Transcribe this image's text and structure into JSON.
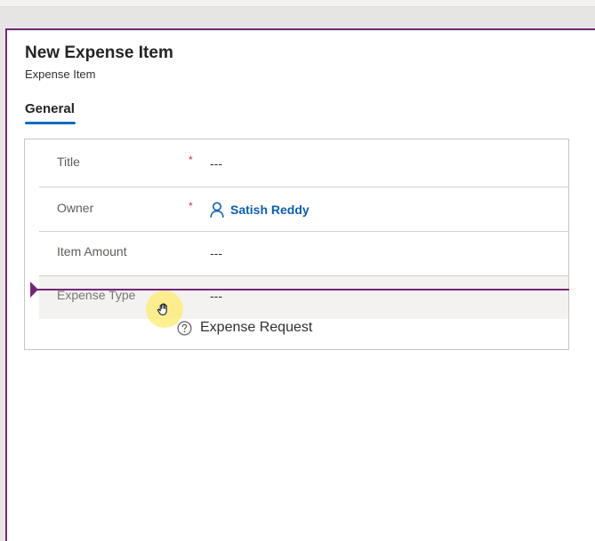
{
  "form": {
    "title": "New Expense Item",
    "subtitle": "Expense Item"
  },
  "tabs": [
    {
      "label": "General",
      "selected": true
    }
  ],
  "fields": [
    {
      "label": "Title",
      "required": true,
      "required_mark": "*",
      "value": "---"
    },
    {
      "label": "Owner",
      "required": true,
      "required_mark": "*",
      "value": "Satish Reddy",
      "value_icon": "person-icon"
    },
    {
      "label": "Item Amount",
      "required": false,
      "value": "---"
    },
    {
      "label": "Expense Type",
      "required": false,
      "value": "---"
    }
  ],
  "drag": {
    "ghost_label": "Expense Request",
    "ghost_icon": "help-circle-icon",
    "cursor_icon": "hand-grab-cursor-icon"
  },
  "colors": {
    "accent": "#742774",
    "tab_underline": "#0f6cbd",
    "link": "#0f5ea8",
    "required": "#d13438",
    "cursor_highlight": "#ffec6e"
  }
}
